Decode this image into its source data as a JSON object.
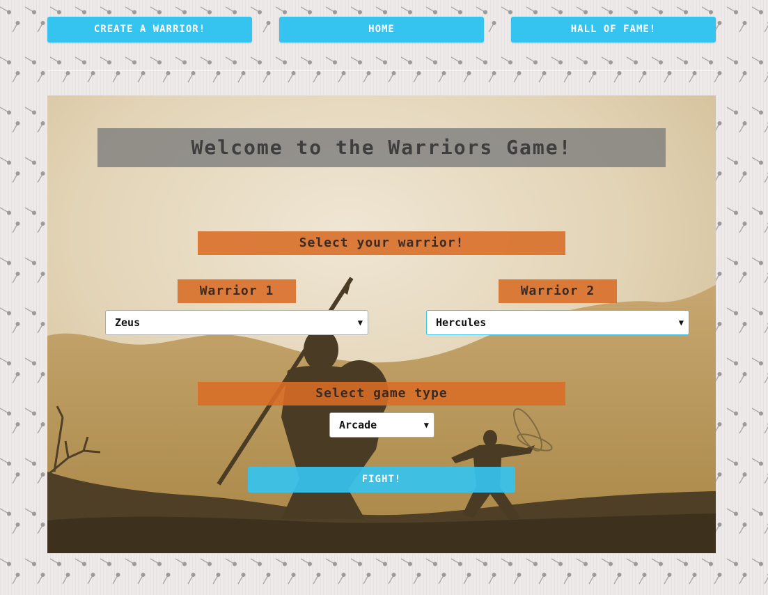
{
  "nav": {
    "create_label": "CREATE A WARRIOR!",
    "home_label": "HOME",
    "hall_label": "HALL OF FAME!"
  },
  "main": {
    "title": "Welcome to the Warriors Game!",
    "select_warrior_label": "Select your warrior!",
    "warrior1": {
      "label": "Warrior 1",
      "selected": "Zeus"
    },
    "warrior2": {
      "label": "Warrior 2",
      "selected": "Hercules"
    },
    "game_type": {
      "label": "Select game type",
      "selected": "Arcade"
    },
    "fight_label": "FIGHT!"
  },
  "colors": {
    "nav_button": "#35c3ef",
    "label_orange": "#d86c26",
    "title_gray": "#7d7d7d",
    "parchment": "#e9dcc2",
    "silhouette": "#4a3c24"
  }
}
